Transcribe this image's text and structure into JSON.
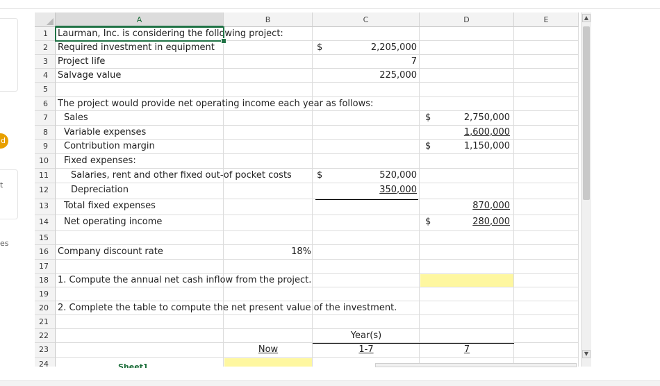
{
  "left_panel": {
    "badge_text": "d",
    "partial_label_1": "t",
    "partial_label_2": "es"
  },
  "spreadsheet": {
    "columns": [
      "A",
      "B",
      "C",
      "D",
      "E"
    ],
    "selected_column": "A",
    "sheet_tab": "Sheet1",
    "rows": [
      {
        "n": "1",
        "a": "Laurman, Inc. is considering the following project:"
      },
      {
        "n": "2",
        "a": "Required investment in equipment",
        "b_sym": "$",
        "c": "2,205,000"
      },
      {
        "n": "3",
        "a": "Project life",
        "c": "7"
      },
      {
        "n": "4",
        "a": "Salvage value",
        "c": "225,000"
      },
      {
        "n": "5"
      },
      {
        "n": "6",
        "a": "The project would provide net operating income each year as follows:"
      },
      {
        "n": "7",
        "a": "Sales",
        "c_sym": "$",
        "d": "2,750,000"
      },
      {
        "n": "8",
        "a": "Variable expenses",
        "d": "1,600,000"
      },
      {
        "n": "9",
        "a": "Contribution margin",
        "c_sym": "$",
        "d": "1,150,000"
      },
      {
        "n": "10",
        "a": "Fixed expenses:"
      },
      {
        "n": "11",
        "a": "Salaries, rent and other fixed out-of pocket costs",
        "b_sym": "$",
        "c": "520,000"
      },
      {
        "n": "12",
        "a": "Depreciation",
        "c": "350,000"
      },
      {
        "n": "13",
        "a": "Total fixed expenses",
        "d": "870,000"
      },
      {
        "n": "14",
        "a": "Net operating income",
        "c_sym": "$",
        "d": "280,000"
      },
      {
        "n": "15"
      },
      {
        "n": "16",
        "a": "Company discount rate",
        "b": "18%"
      },
      {
        "n": "17"
      },
      {
        "n": "18",
        "a": "1. Compute the annual net cash inflow from the project."
      },
      {
        "n": "19"
      },
      {
        "n": "20",
        "a": "2. Complete the table to compute the net present value of the investment."
      },
      {
        "n": "21"
      },
      {
        "n": "22",
        "c": "Year(s)"
      },
      {
        "n": "23",
        "b": "Now",
        "c": "1-7",
        "d": "7"
      },
      {
        "n": "24"
      }
    ]
  },
  "colors": {
    "input_fill": "#fef7a0",
    "selection": "#217346"
  }
}
